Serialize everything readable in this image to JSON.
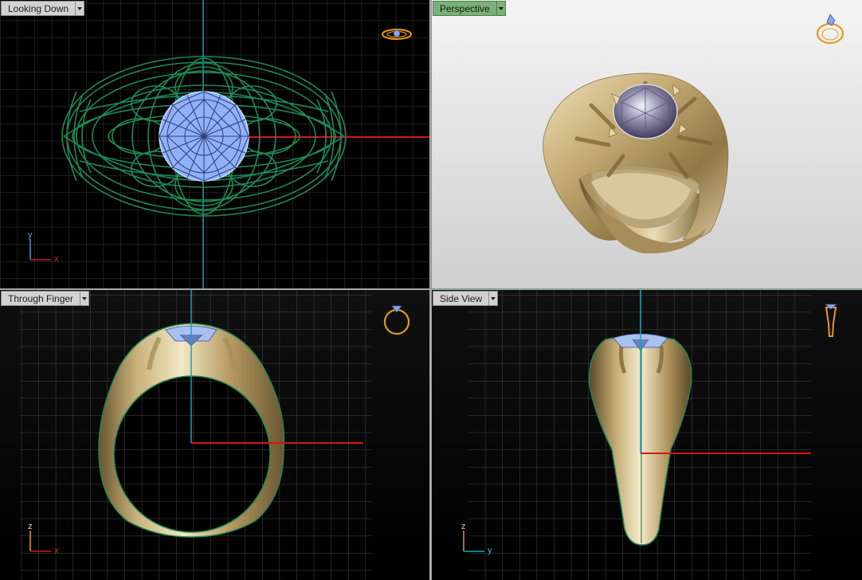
{
  "viewports": {
    "top": {
      "label": "Looking Down",
      "axis_v": "y",
      "axis_h": "x"
    },
    "perspective": {
      "label": "Perspective"
    },
    "front": {
      "label": "Through Finger",
      "axis_v": "z",
      "axis_h": "x"
    },
    "side": {
      "label": "Side View",
      "axis_v": "z",
      "axis_h": "y"
    }
  },
  "icons": {
    "dropdown": "chevron-down-icon",
    "nav_top": "ring-top-view-icon",
    "nav_perspective": "ring-perspective-icon",
    "nav_front": "ring-front-view-icon",
    "nav_side": "ring-side-view-icon"
  },
  "colors": {
    "grid": "#3a3a3a",
    "wireframe_shank": "#1f8a55",
    "wireframe_stone": "#8fb2ff",
    "axis_x": "#d01818",
    "axis_y_z": "#1ea0b4",
    "gold": "#c9b27c",
    "active_label": "#7ab07a"
  }
}
